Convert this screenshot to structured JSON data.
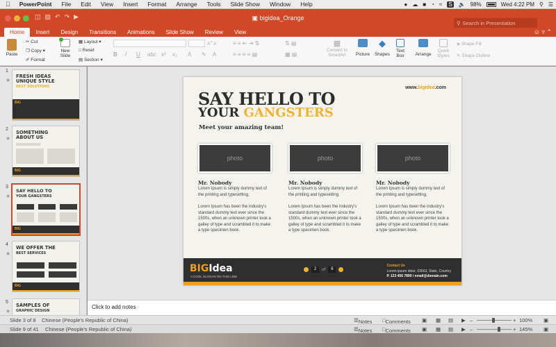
{
  "menubar": {
    "apple": "",
    "app": "PowerPoint",
    "items": [
      "File",
      "Edit",
      "View",
      "Insert",
      "Format",
      "Arrange",
      "Tools",
      "Slide Show",
      "Window",
      "Help"
    ],
    "battery": "98%",
    "clock": "Wed 4:22 PM"
  },
  "window": {
    "title": "bigidea_Orange",
    "search_placeholder": "Search in Presentation"
  },
  "tabs": [
    "Home",
    "Insert",
    "Design",
    "Transitions",
    "Animations",
    "Slide Show",
    "Review",
    "View"
  ],
  "ribbon": {
    "paste": "Paste",
    "cut": "Cut",
    "copy": "Copy",
    "format": "Format",
    "new_slide": "New Slide",
    "layout": "Layout",
    "reset": "Reset",
    "section": "Section",
    "convert": "Convert to SmartArt",
    "picture": "Picture",
    "shapes": "Shapes",
    "textbox": "Text Box",
    "arrange": "Arrange",
    "quick_styles": "Quick Styles",
    "shape_fill": "Shape Fill",
    "shape_outline": "Shape Outline"
  },
  "thumbnails": [
    {
      "num": "1",
      "l1": "FRESH IDEAS",
      "l2": "UNIQUE STYLE",
      "l3": "BEST SOLUTIONS"
    },
    {
      "num": "2",
      "l1": "SOMETHING",
      "l2": "ABOUT US",
      "l3": ""
    },
    {
      "num": "3",
      "l1": "SAY HELLO TO",
      "l2": "YOUR GANGSTERS",
      "l3": ""
    },
    {
      "num": "4",
      "l1": "WE OFFER THE",
      "l2": "BEST SERVICES",
      "l3": ""
    },
    {
      "num": "5",
      "l1": "SAMPLES OF",
      "l2": "GRAPHIC DESIGN",
      "l3": ""
    }
  ],
  "slide": {
    "url_prefix": "www.",
    "url_brand": "bigidea",
    "url_suffix": ".com",
    "h1": "SAY HELLO TO",
    "h2a": "YOUR ",
    "h2b": "GANGSTERS",
    "sub": "Meet your amazing team!",
    "cards": [
      {
        "photo": "photo",
        "name": "Mr. Nobody",
        "t1": "Lorem Ipsum is simply dummy text of the printing and typesetting.",
        "t2": "Lorem Ipsum has been the industry's standard dummy text ever since the 1500s, when an unknown printer took a galley of type and scrambled it to make a type specimen book."
      },
      {
        "photo": "photo",
        "name": "Mr. Nobody",
        "t1": "Lorem Ipsum is simply dummy text of the printing and typesetting.",
        "t2": "Lorem Ipsum has been the industry's standard dummy text ever since the 1500s, when an unknown printer took a galley of type and scrambled it to make a type specimen book."
      },
      {
        "photo": "photo",
        "name": "Mr. Nobody",
        "t1": "Lorem Ipsum is simply dummy text of the printing and typesetting.",
        "t2": "Lorem Ipsum has been the industry's standard dummy text ever since the 1500s, when an unknown printer took a galley of type and scrambled it to make a type specimen book."
      }
    ],
    "logo_a": "BIG",
    "logo_b": "Idea",
    "tagline": "A COOL SLOGAN ON THIS LINE",
    "page_current": "2",
    "page_of": "of",
    "page_total": "6",
    "contact_title": "Contact Us",
    "contact_l1": "Lorem ipsum dolor, 03663, State, Country",
    "contact_l2": "P. 123 456 7890 / email@domain.com"
  },
  "notes_placeholder": "Click to add notes",
  "status1": {
    "slide": "Slide 3 of 8",
    "lang": "Chinese (People's Republic of China)",
    "notes": "Notes",
    "comments": "Comments",
    "zoom": "100%"
  },
  "status2": {
    "slide": "Slide 9 of 41",
    "lang": "Chinese (People's Republic of China)",
    "notes": "Notes",
    "comments": "Comments",
    "zoom": "145%"
  },
  "colors": {
    "accent": "#d24726",
    "brand": "#f0a020"
  }
}
